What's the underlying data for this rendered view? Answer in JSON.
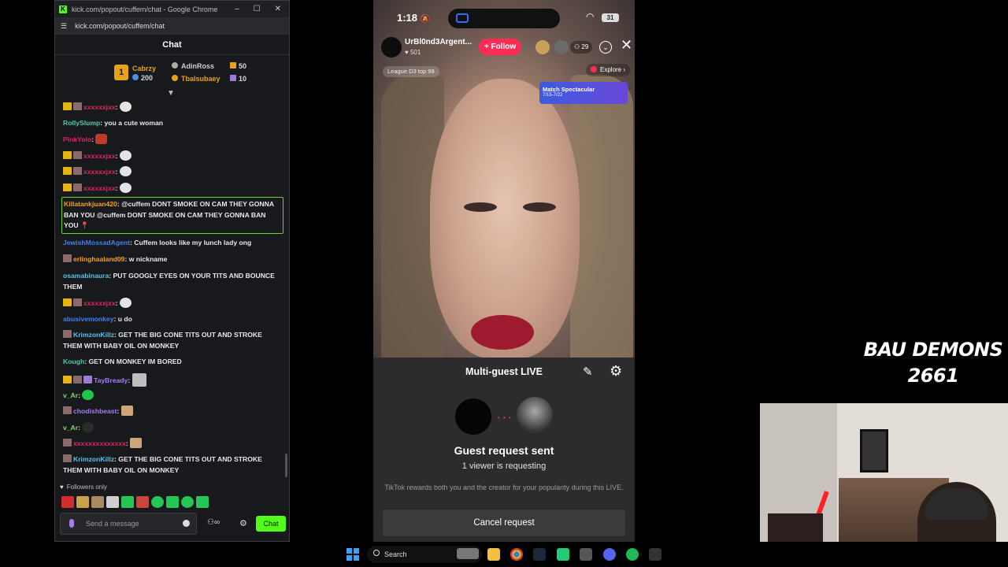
{
  "chat_window": {
    "title": "kick.com/popout/cuffem/chat - Google Chrome",
    "url": "kick.com/popout/cuffem/chat",
    "header": "Chat",
    "window_controls": [
      "–",
      "☐",
      "✕"
    ],
    "leaderboard": [
      {
        "name": "Cabrzy",
        "value": "200"
      },
      {
        "name": "AdinRoss",
        "value": "50"
      },
      {
        "name": "Tbalsubaey",
        "value": "10"
      }
    ],
    "coin_label": "1",
    "messages": [
      {
        "user": "xxxxxxjxx",
        "text": ""
      },
      {
        "user": "RollySlump",
        "text": "you a cute woman"
      },
      {
        "user": "PinkYolo",
        "text": ""
      },
      {
        "user": "xxxxxxjxx",
        "text": ""
      },
      {
        "user": "xxxxxxjxx",
        "text": ""
      },
      {
        "user": "xxxxxxjxx",
        "text": ""
      },
      {
        "user": "Killatankjuan420",
        "text": "@cuffem DONT SMOKE ON CAM THEY GONNA BAN YOU @cuffem DONT SMOKE ON CAM THEY GONNA BAN YOU"
      },
      {
        "user": "JewishMossadAgent",
        "text": "Cuffem looks like my lunch lady ong"
      },
      {
        "user": "erlinghaaland09",
        "text": "w nickname"
      },
      {
        "user": "osamabinaura",
        "text": "PUT GOOGLY EYES ON YOUR TITS AND BOUNCE THEM"
      },
      {
        "user": "xxxxxxjxx",
        "text": ""
      },
      {
        "user": "abusivemonkey",
        "text": "u do"
      },
      {
        "user": "KrimzonKillz",
        "text": "GET THE BIG CONE TITS OUT AND STROKE THEM WITH BABY OIL ON MONKEY"
      },
      {
        "user": "Kough",
        "text": "GET ON MONKEY IM BORED"
      },
      {
        "user": "TayBready",
        "text": ""
      },
      {
        "user": "v_Ar",
        "text": ""
      },
      {
        "user": "chodishbeast",
        "text": ""
      },
      {
        "user": "v_Ar",
        "text": ""
      },
      {
        "user": "xxxxxxxxxxxxxx",
        "text": ""
      },
      {
        "user": "KrimzonKillz",
        "text": "GET THE BIG CONE TITS OUT AND STROKE THEM WITH BABY OIL ON MONKEY"
      }
    ],
    "followers_only": "Followers only",
    "input_placeholder": "Send a message",
    "send_label": "Chat",
    "accent_color": "#53fc18"
  },
  "phone": {
    "status_time": "1:18",
    "battery": "31",
    "host_name": "UrBl0nd3Argent...",
    "host_likes": "501",
    "follow_label": "+ Follow",
    "viewer_count": "29",
    "league_tag": "League D3 top 99",
    "explore_label": "Explore ›",
    "match_banner_title": "Match Spectacular",
    "match_banner_dates": "7/15-7/22",
    "sheet_title": "Multi-guest LIVE",
    "request_title": "Guest request sent",
    "request_sub": "1 viewer is requesting",
    "reward_text": "TikTok rewards both you and the creator for your popularity during this LIVE.",
    "cancel_label": "Cancel request",
    "follow_color": "#fe2c55"
  },
  "overlay": {
    "line1": "BAU DEMONS",
    "line2": "2661"
  },
  "taskbar": {
    "search_label": "Search"
  }
}
